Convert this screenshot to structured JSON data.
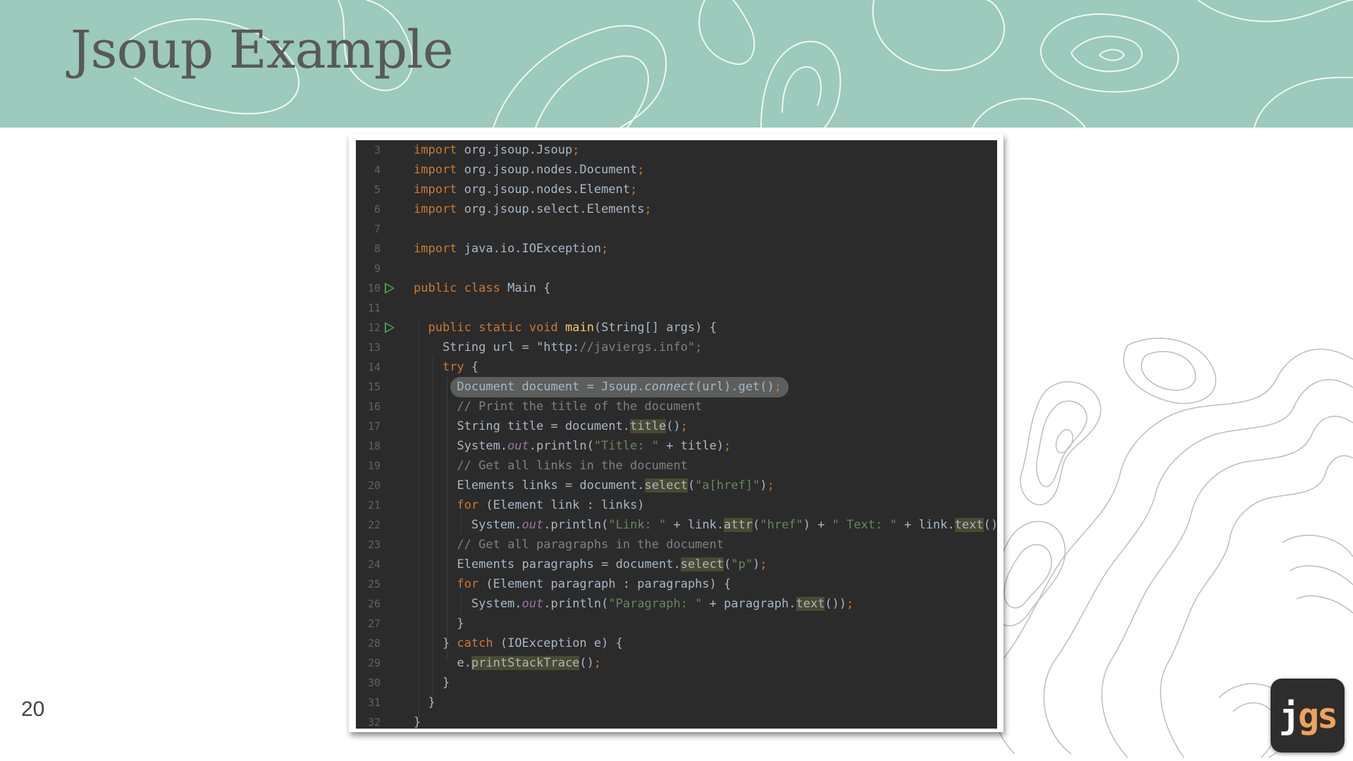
{
  "slide": {
    "title": "Jsoup Example",
    "page_number": "20",
    "logo": {
      "j": "j",
      "gs": "gs"
    }
  },
  "colors": {
    "header_band": "#9ccabd",
    "title_text": "#595959",
    "editor_background": "#2b2b2b",
    "keyword": "#cc7832",
    "string": "#6a8759",
    "comment": "#808080",
    "logo_accent": "#f0a25c"
  },
  "icons": {
    "run_gutter": "play-triangle-icon"
  },
  "code": {
    "language": "java",
    "lines": [
      {
        "n": "3",
        "run": false,
        "text": "import org.jsoup.Jsoup;"
      },
      {
        "n": "4",
        "run": false,
        "text": "import org.jsoup.nodes.Document;"
      },
      {
        "n": "5",
        "run": false,
        "text": "import org.jsoup.nodes.Element;"
      },
      {
        "n": "6",
        "run": false,
        "text": "import org.jsoup.select.Elements;"
      },
      {
        "n": "7",
        "run": false,
        "text": ""
      },
      {
        "n": "8",
        "run": false,
        "text": "import java.io.IOException;"
      },
      {
        "n": "9",
        "run": false,
        "text": ""
      },
      {
        "n": "10",
        "run": true,
        "text": "public class Main {"
      },
      {
        "n": "11",
        "run": false,
        "text": ""
      },
      {
        "n": "12",
        "run": true,
        "text": "  public static void main(String[] args) {"
      },
      {
        "n": "13",
        "run": false,
        "text": "    String url = \"http://javiergs.info\";"
      },
      {
        "n": "14",
        "run": false,
        "text": "    try {"
      },
      {
        "n": "15",
        "run": false,
        "text": "      Document document = Jsoup.connect(url).get();"
      },
      {
        "n": "16",
        "run": false,
        "text": "      // Print the title of the document"
      },
      {
        "n": "17",
        "run": false,
        "text": "      String title = document.title();"
      },
      {
        "n": "18",
        "run": false,
        "text": "      System.out.println(\"Title: \" + title);"
      },
      {
        "n": "19",
        "run": false,
        "text": "      // Get all links in the document"
      },
      {
        "n": "20",
        "run": false,
        "text": "      Elements links = document.select(\"a[href]\");"
      },
      {
        "n": "21",
        "run": false,
        "text": "      for (Element link : links)"
      },
      {
        "n": "22",
        "run": false,
        "text": "        System.out.println(\"Link: \" + link.attr(\"href\") + \" Text: \" + link.text());"
      },
      {
        "n": "23",
        "run": false,
        "text": "      // Get all paragraphs in the document"
      },
      {
        "n": "24",
        "run": false,
        "text": "      Elements paragraphs = document.select(\"p\");"
      },
      {
        "n": "25",
        "run": false,
        "text": "      for (Element paragraph : paragraphs) {"
      },
      {
        "n": "26",
        "run": false,
        "text": "        System.out.println(\"Paragraph: \" + paragraph.text());"
      },
      {
        "n": "27",
        "run": false,
        "text": "      }"
      },
      {
        "n": "28",
        "run": false,
        "text": "    } catch (IOException e) {"
      },
      {
        "n": "29",
        "run": false,
        "text": "      e.printStackTrace();"
      },
      {
        "n": "30",
        "run": false,
        "text": "    }"
      },
      {
        "n": "31",
        "run": false,
        "text": "  }"
      },
      {
        "n": "32",
        "run": false,
        "text": "}"
      }
    ]
  }
}
